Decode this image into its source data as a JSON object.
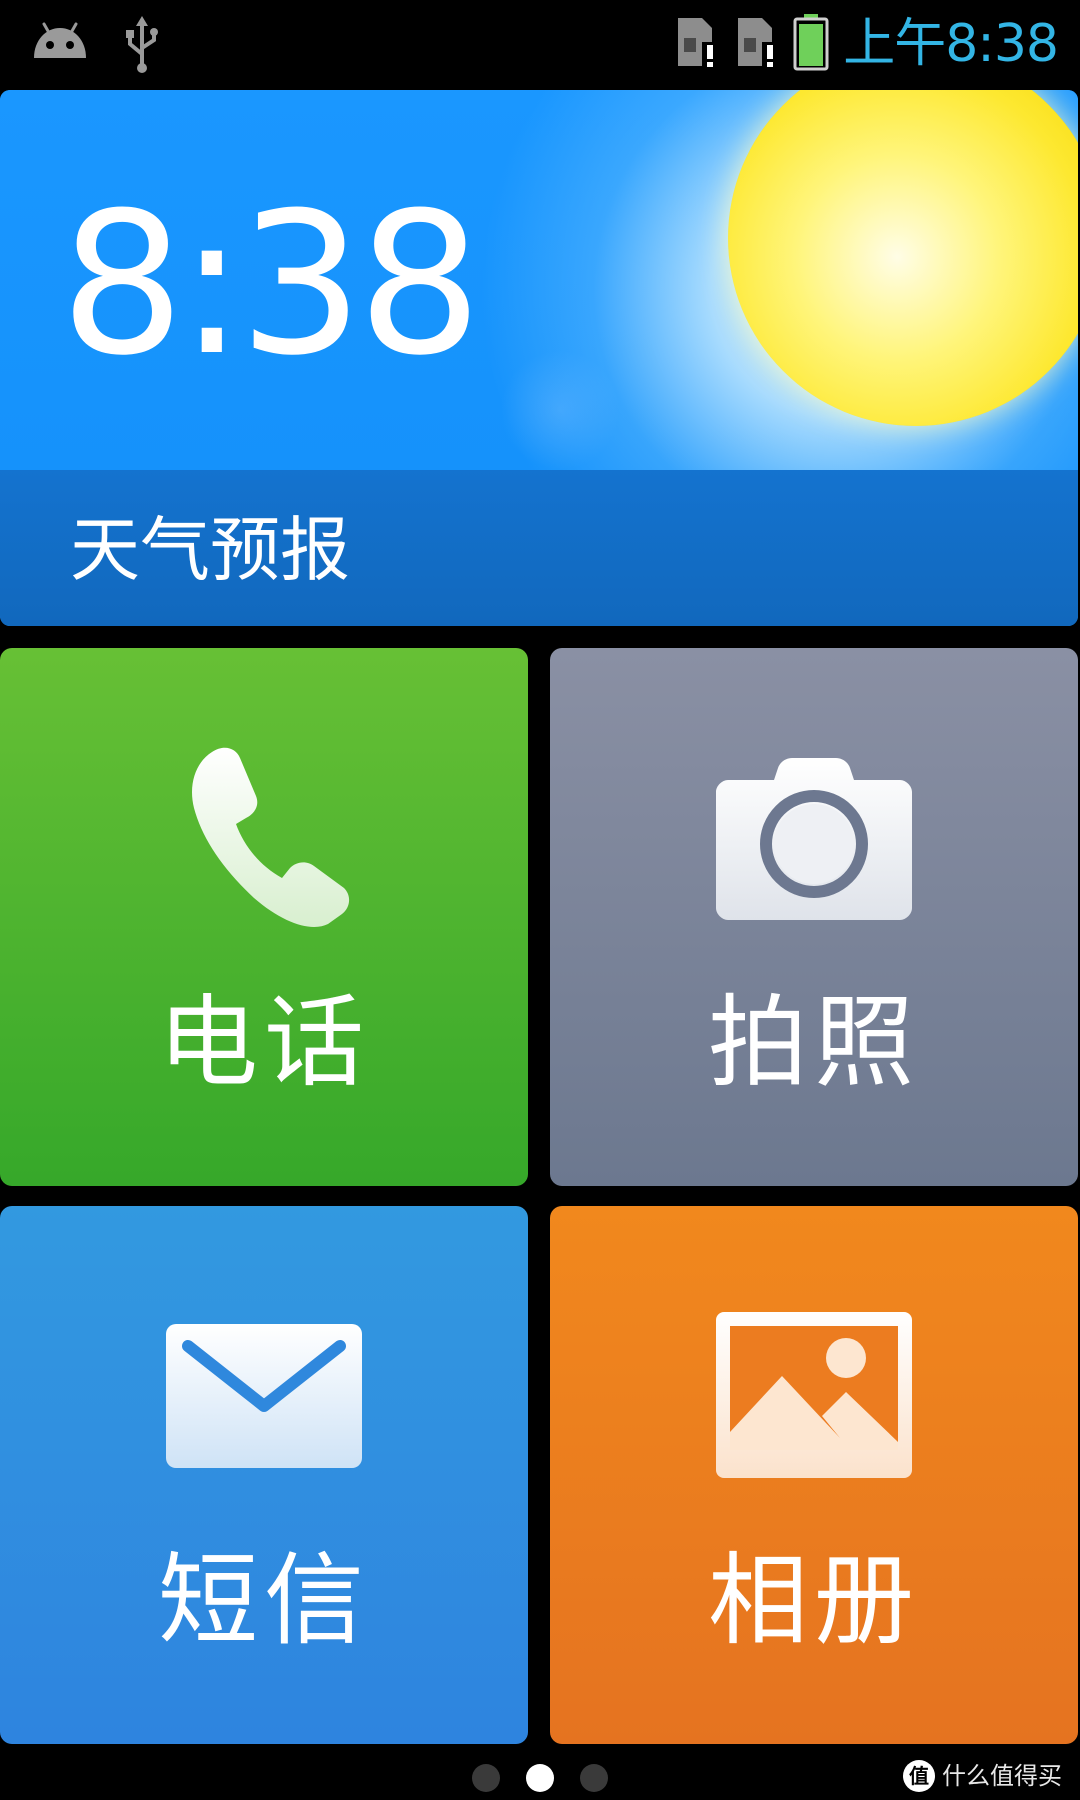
{
  "status_bar": {
    "time": "上午8:38",
    "icons": [
      "android-debug-icon",
      "usb-icon",
      "sim-card-alert-icon",
      "sim-card-alert-icon",
      "battery-icon"
    ]
  },
  "weather": {
    "time": "8:38",
    "label": "天气预报",
    "condition_icon": "sun-icon"
  },
  "tiles": [
    {
      "label": "电话",
      "icon": "phone-handset-icon",
      "color": "#4db52f"
    },
    {
      "label": "拍照",
      "icon": "camera-icon",
      "color": "#7a8399"
    },
    {
      "label": "短信",
      "icon": "envelope-icon",
      "color": "#308fe0"
    },
    {
      "label": "相册",
      "icon": "picture-icon",
      "color": "#eb7d1f"
    }
  ],
  "page_indicator": {
    "count": 3,
    "active_index": 1
  },
  "watermark": {
    "text": "什么值得买",
    "logo": "zhide-logo-icon"
  },
  "colors": {
    "status_time": "#33b5e5",
    "weather_sky": "#1694ff",
    "weather_bar": "#126dc6"
  }
}
